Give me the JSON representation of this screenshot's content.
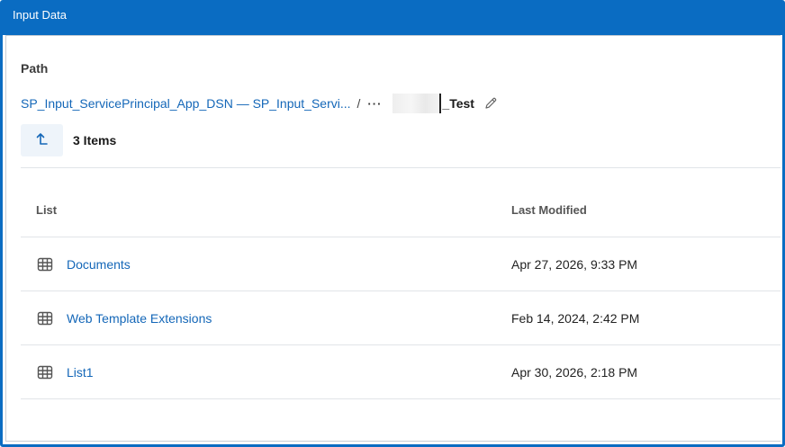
{
  "window": {
    "title": "Input Data"
  },
  "path": {
    "label": "Path",
    "breadcrumb_link": "SP_Input_ServicePrincipal_App_DSN — SP_Input_Servi...",
    "separator": "/",
    "overflow": "···",
    "current_visible": "_Test"
  },
  "toolbar": {
    "item_count": "3 Items"
  },
  "table": {
    "columns": [
      "List",
      "Last Modified"
    ],
    "rows": [
      {
        "name": "Documents",
        "modified": "Apr 27, 2026, 9:33 PM"
      },
      {
        "name": "Web Template Extensions",
        "modified": "Feb 14, 2024, 2:42 PM"
      },
      {
        "name": "List1",
        "modified": "Apr 30, 2026, 2:18 PM"
      }
    ]
  },
  "colors": {
    "accent": "#0a6cc2",
    "link": "#1467b8"
  },
  "icons": {
    "up": "arrow-up-icon",
    "edit": "pencil-icon",
    "list": "grid-list-icon"
  }
}
